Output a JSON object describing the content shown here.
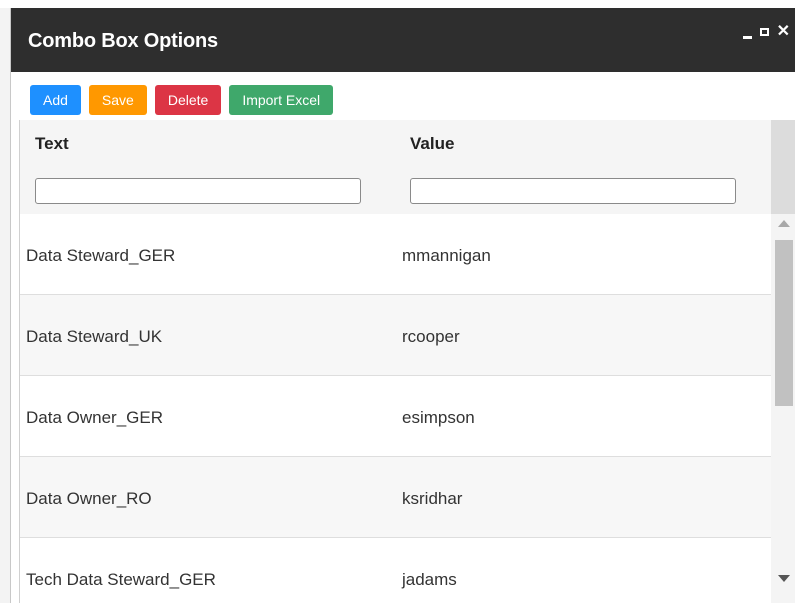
{
  "dialog": {
    "title": "Combo Box Options"
  },
  "toolbar": {
    "add_label": "Add",
    "save_label": "Save",
    "delete_label": "Delete",
    "import_label": "Import Excel"
  },
  "grid": {
    "columns": [
      "Text",
      "Value"
    ],
    "filters": [
      "",
      ""
    ],
    "rows": [
      {
        "text": "Data Steward_GER",
        "value": "mmannigan"
      },
      {
        "text": "Data Steward_UK",
        "value": "rcooper"
      },
      {
        "text": "Data Owner_GER",
        "value": "esimpson"
      },
      {
        "text": "Data Owner_RO",
        "value": "ksridhar"
      },
      {
        "text": "Tech Data Steward_GER",
        "value": "jadams"
      }
    ]
  },
  "colors": {
    "titlebar": "#2e2e2e",
    "add": "#1e90ff",
    "save": "#ff9800",
    "delete": "#dc3545",
    "import": "#3fa86b"
  },
  "icons": {
    "minimize": "minimize-icon",
    "maximize": "maximize-icon",
    "close": "close-icon"
  }
}
